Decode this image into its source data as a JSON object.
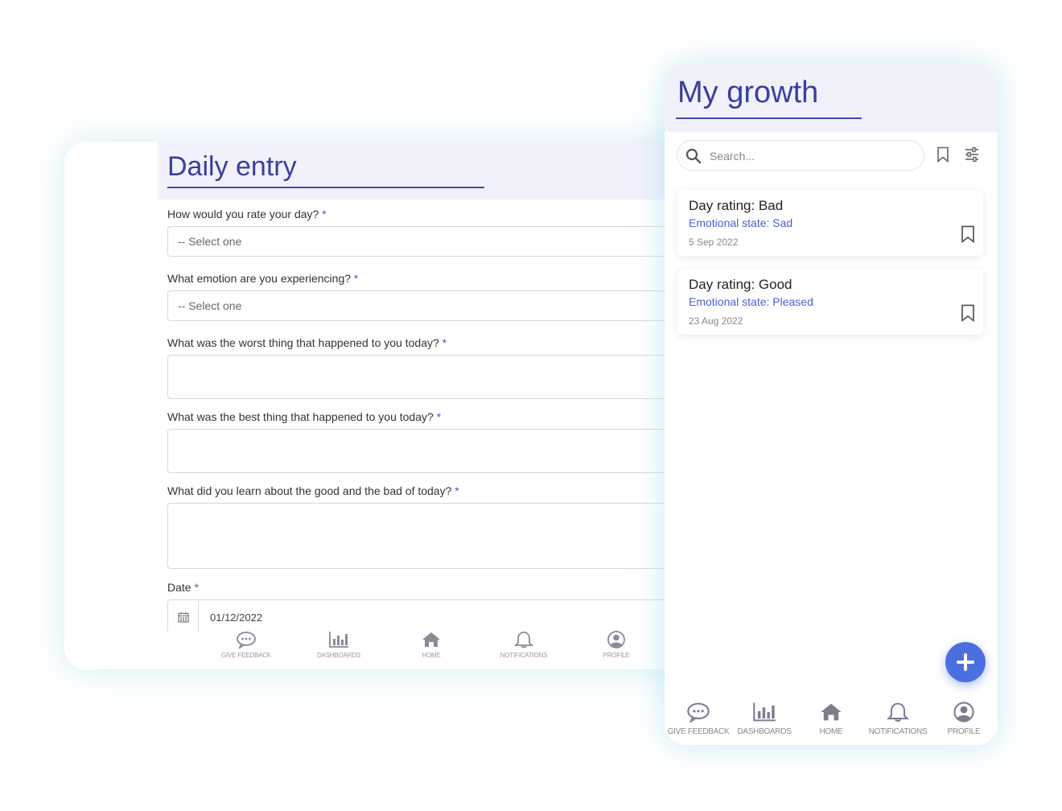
{
  "daily_entry": {
    "title": "Daily entry",
    "fields": [
      {
        "label": "How would you rate your day?",
        "required": "*",
        "type": "select",
        "value": "-- Select one"
      },
      {
        "label": "What emotion are you experiencing?",
        "required": "*",
        "type": "select",
        "value": "-- Select one"
      },
      {
        "label": "What was the worst thing that happened to you today?",
        "required": "*",
        "type": "textarea",
        "value": ""
      },
      {
        "label": "What was the best thing that happened to you today?",
        "required": "*",
        "type": "textarea",
        "value": ""
      },
      {
        "label": "What did you learn about the good and the bad of today?",
        "required": "*",
        "type": "textarea",
        "value": ""
      },
      {
        "label": "Date",
        "required": "*",
        "type": "date",
        "value": "01/12/2022"
      }
    ],
    "nav": [
      {
        "label": "GIVE FEEDBACK",
        "icon": "chat-bubble-icon"
      },
      {
        "label": "DASHBOARDS",
        "icon": "bar-chart-icon"
      },
      {
        "label": "HOME",
        "icon": "home-icon"
      },
      {
        "label": "NOTIFICATIONS",
        "icon": "bell-icon"
      },
      {
        "label": "PROFILE",
        "icon": "profile-icon"
      }
    ]
  },
  "my_growth": {
    "title": "My growth",
    "search": {
      "placeholder": "Search..."
    },
    "entries": [
      {
        "title": "Day rating: Bad",
        "emotion": "Emotional state: Sad",
        "date": "5 Sep 2022"
      },
      {
        "title": "Day rating: Good",
        "emotion": "Emotional state: Pleased",
        "date": "23 Aug 2022"
      }
    ],
    "nav": [
      {
        "label": "GIVE FEEDBACK",
        "icon": "chat-bubble-icon"
      },
      {
        "label": "DASHBOARDS",
        "icon": "bar-chart-icon"
      },
      {
        "label": "HOME",
        "icon": "home-icon"
      },
      {
        "label": "NOTIFICATIONS",
        "icon": "bell-icon"
      },
      {
        "label": "PROFILE",
        "icon": "profile-icon"
      }
    ]
  },
  "colors": {
    "accent": "#3a3f9b",
    "link": "#4a5fd1",
    "fab": "#4c6fe0",
    "header_bg": "#f1f1fc"
  }
}
